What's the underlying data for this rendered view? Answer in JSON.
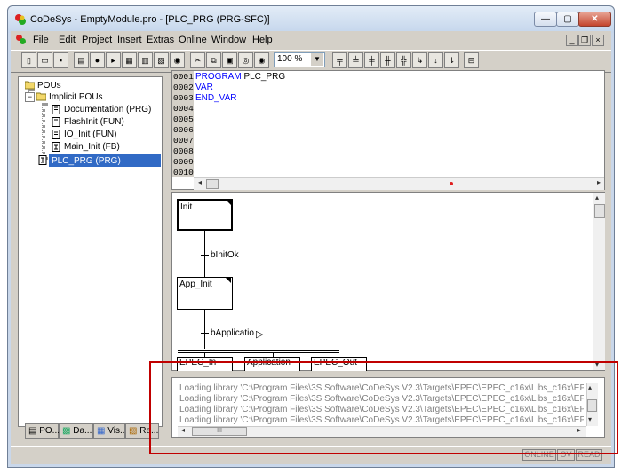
{
  "window": {
    "title": "CoDeSys - EmptyModule.pro - [PLC_PRG (PRG-SFC)]",
    "min_glyph": "—",
    "max_glyph": "▢",
    "close_glyph": "✕"
  },
  "menu": {
    "items": [
      "File",
      "Edit",
      "Project",
      "Insert",
      "Extras",
      "Online",
      "Window",
      "Help"
    ],
    "mdi_min": "_",
    "mdi_restore": "❐",
    "mdi_close": "×"
  },
  "toolbar": {
    "zoom": "100 %"
  },
  "tree": {
    "root": "POUs",
    "folder": "Implicit POUs",
    "children": [
      "Documentation (PRG)",
      "FlashInit (FUN)",
      "IO_Init (FUN)",
      "Main_Init (FB)"
    ],
    "selected": "PLC_PRG (PRG)"
  },
  "tabs": [
    {
      "label": "PO..."
    },
    {
      "label": "Da..."
    },
    {
      "label": "Vis..."
    },
    {
      "label": "Re..."
    }
  ],
  "declaration": {
    "line_numbers": [
      "0001",
      "0002",
      "0003",
      "0004",
      "0005",
      "0006",
      "0007",
      "0008",
      "0009",
      "0010"
    ],
    "lines": [
      {
        "kw": "PROGRAM",
        "rest": " PLC_PRG"
      },
      {
        "kw": "VAR",
        "rest": ""
      },
      {
        "kw": "END_VAR",
        "rest": ""
      }
    ]
  },
  "sfc": {
    "steps": [
      "Init",
      "App_Init"
    ],
    "transitions": [
      "bInitOk",
      "bApplicatio"
    ],
    "parallel_steps": [
      "EPEC_In",
      "Application",
      "EPEC_Out"
    ]
  },
  "messages": [
    "Loading library 'C:\\Program Files\\3S Software\\CoDeSys V2.3\\Targets\\EPEC\\EPEC_c16x\\Libs_c16x\\EPEC_",
    "Loading library 'C:\\Program Files\\3S Software\\CoDeSys V2.3\\Targets\\EPEC\\EPEC_c16x\\Libs_c16x\\EPEC_",
    "Loading library 'C:\\Program Files\\3S Software\\CoDeSys V2.3\\Targets\\EPEC\\EPEC_c16x\\Libs_c16x\\EPEC_",
    "Loading library 'C:\\Program Files\\3S Software\\CoDeSys V2.3\\Targets\\EPEC\\EPEC_c16x\\Libs_c16x\\EPEC_"
  ],
  "msg_scroll_thumb": "III",
  "status": {
    "online": "ONLINE",
    "ov": "OV",
    "read": "READ"
  },
  "colors": {
    "highlight_border": "#c00000",
    "selection": "#316ac5",
    "keyword": "#0000ff"
  }
}
